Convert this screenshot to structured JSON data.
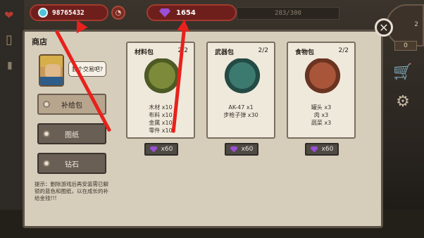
{
  "hud": {
    "coins": "98765432",
    "gems": "1654",
    "capacity": "283/300",
    "clock": "2"
  },
  "side": {
    "gold_value": "0"
  },
  "shop": {
    "title": "商店",
    "speech": "我个交易吧?",
    "categories": [
      {
        "label": "补给包",
        "active": true
      },
      {
        "label": "图纸",
        "active": false
      },
      {
        "label": "钻石",
        "active": false
      }
    ],
    "hint": "提示：删除游戏后再安装需已解锁的蓝色和图纸，以在成长的补给金钱!!!",
    "cards": [
      {
        "title": "材料包",
        "qty": "2/2",
        "lines": [
          "木材 x10",
          "布料 x10",
          "金属 x10",
          "零件 x10"
        ],
        "price": "x60"
      },
      {
        "title": "武器包",
        "qty": "2/2",
        "lines": [
          "AK-47 x1",
          "步枪子弹 x30"
        ],
        "price": "x60"
      },
      {
        "title": "食物包",
        "qty": "2/2",
        "lines": [
          "罐头 x3",
          "肉 x3",
          "蔬菜 x3"
        ],
        "price": "x60"
      }
    ]
  },
  "colors": {
    "accent_red": "#e8211c",
    "gem_purple": "#9b4fd6",
    "hud_red": "#6e1f1c"
  }
}
